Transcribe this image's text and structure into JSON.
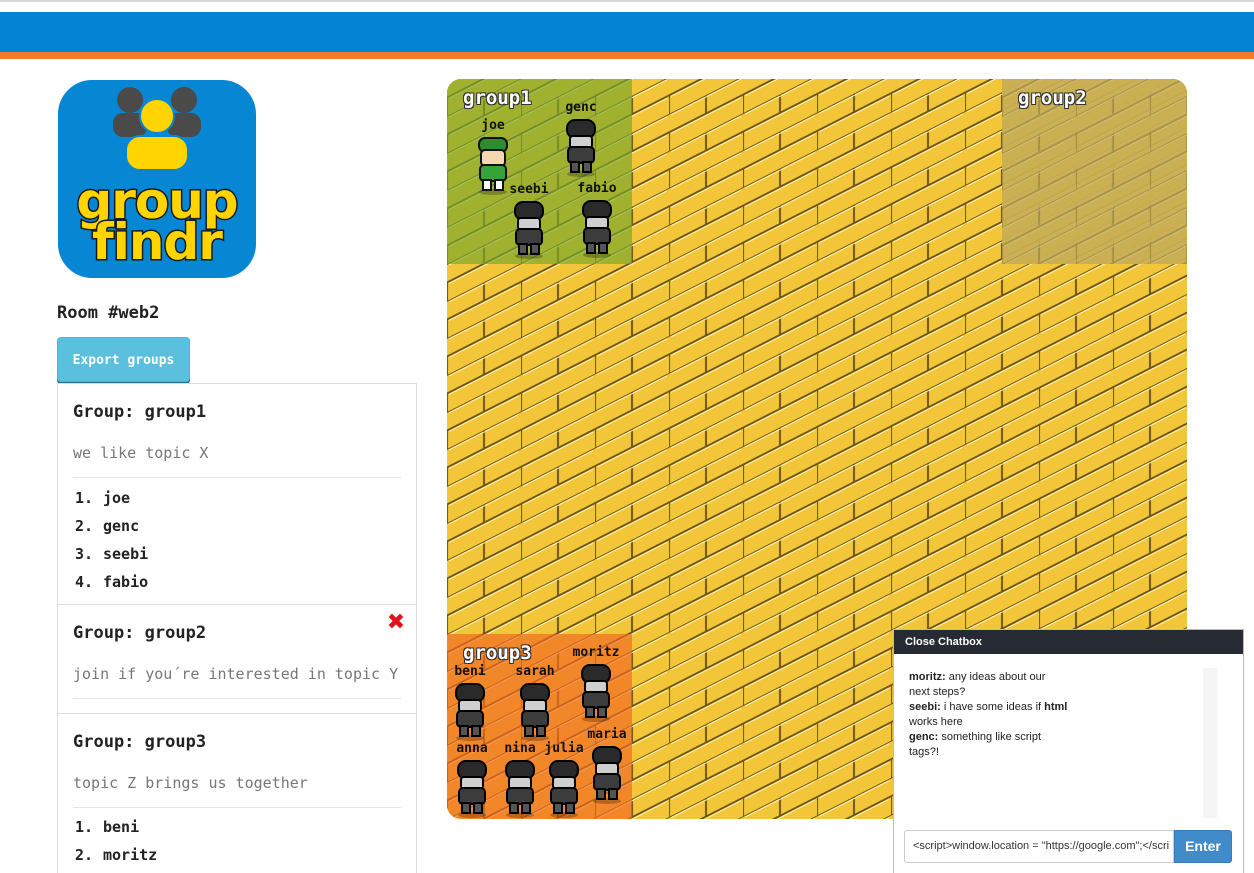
{
  "header": {
    "bar_color": "#0483d2",
    "stripe_color": "#f27a2f"
  },
  "logo": {
    "line1": "group",
    "line2": "findr",
    "icon": "group-people-icon"
  },
  "room": {
    "title": "Room #web2"
  },
  "toolbar": {
    "export_label": "Export groups"
  },
  "groups": [
    {
      "title": "Group: group1",
      "description": "we like topic X",
      "members": [
        "joe",
        "genc",
        "seebi",
        "fabio"
      ],
      "deletable": false
    },
    {
      "title": "Group: group2",
      "description": "join if you´re interested in topic Y",
      "members": [],
      "deletable": true,
      "delete_icon": "close-icon"
    },
    {
      "title": "Group: group3",
      "description": "topic Z brings us together",
      "members": [
        "beni",
        "moritz"
      ],
      "deletable": false
    }
  ],
  "board": {
    "floor_color": "#f3c63a",
    "zones": [
      {
        "label": "group1",
        "color": "#7aa72a"
      },
      {
        "label": "group2",
        "color": "#b9a55e"
      },
      {
        "label": "group3",
        "color": "#f26a22"
      }
    ],
    "avatars": [
      {
        "name": "joe",
        "style": "green"
      },
      {
        "name": "genc",
        "style": "dark"
      },
      {
        "name": "seebi",
        "style": "dark"
      },
      {
        "name": "fabio",
        "style": "dark"
      },
      {
        "name": "beni",
        "style": "dark"
      },
      {
        "name": "sarah",
        "style": "dark"
      },
      {
        "name": "moritz",
        "style": "dark"
      },
      {
        "name": "anna",
        "style": "dark"
      },
      {
        "name": "nina",
        "style": "dark"
      },
      {
        "name": "julia",
        "style": "dark"
      },
      {
        "name": "maria",
        "style": "dark"
      }
    ]
  },
  "chat": {
    "header": "Close Chatbox",
    "messages": [
      {
        "user": "moritz:",
        "text": " any ideas about our next steps?"
      },
      {
        "user": "seebi:",
        "text": " i have some ideas if ",
        "bold_word": "html",
        "text2": " works here"
      },
      {
        "user": "genc:",
        "text": " something like script tags?!"
      }
    ],
    "input_value": "<script>window.location = \"https://google.com\";</scri",
    "enter_label": "Enter"
  }
}
